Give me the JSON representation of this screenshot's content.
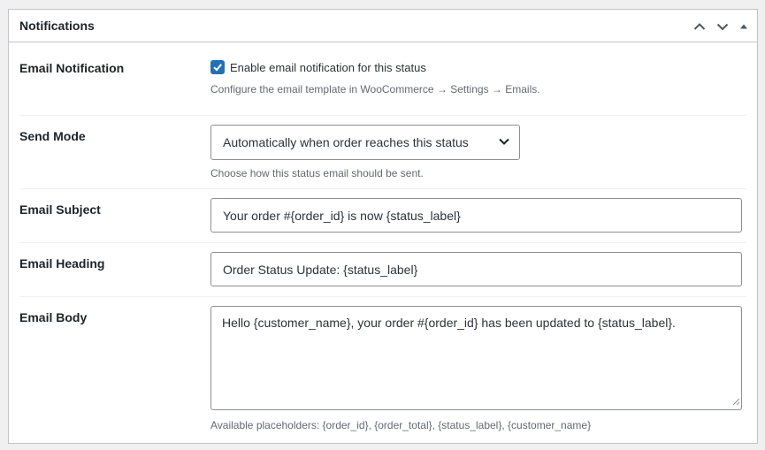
{
  "panel": {
    "title": "Notifications",
    "actions": [
      {
        "name": "move-up-button",
        "icon": "chevron-up-icon"
      },
      {
        "name": "move-down-button",
        "icon": "chevron-down-icon"
      },
      {
        "name": "toggle-panel-button",
        "icon": "caret-up-icon"
      }
    ]
  },
  "fields": {
    "email_notification": {
      "label": "Email Notification",
      "checkbox_label": "Enable email notification for this status",
      "checked": true,
      "description": "Configure the email template in WooCommerce → Settings → Emails."
    },
    "send_mode": {
      "label": "Send Mode",
      "selected": "Automatically when order reaches this status",
      "description": "Choose how this status email should be sent."
    },
    "email_subject": {
      "label": "Email Subject",
      "value": "Your order #{order_id} is now {status_label}"
    },
    "email_heading": {
      "label": "Email Heading",
      "value": "Order Status Update: {status_label}"
    },
    "email_body": {
      "label": "Email Body",
      "value": "Hello {customer_name}, your order #{order_id} has been updated to {status_label}.",
      "description": "Available placeholders: {order_id}, {order_total}, {status_label}, {customer_name}"
    }
  },
  "colors": {
    "accent": "#2271b1",
    "border": "#c3c4c7",
    "muted_text": "#646970",
    "input_border": "#8c8f94"
  }
}
